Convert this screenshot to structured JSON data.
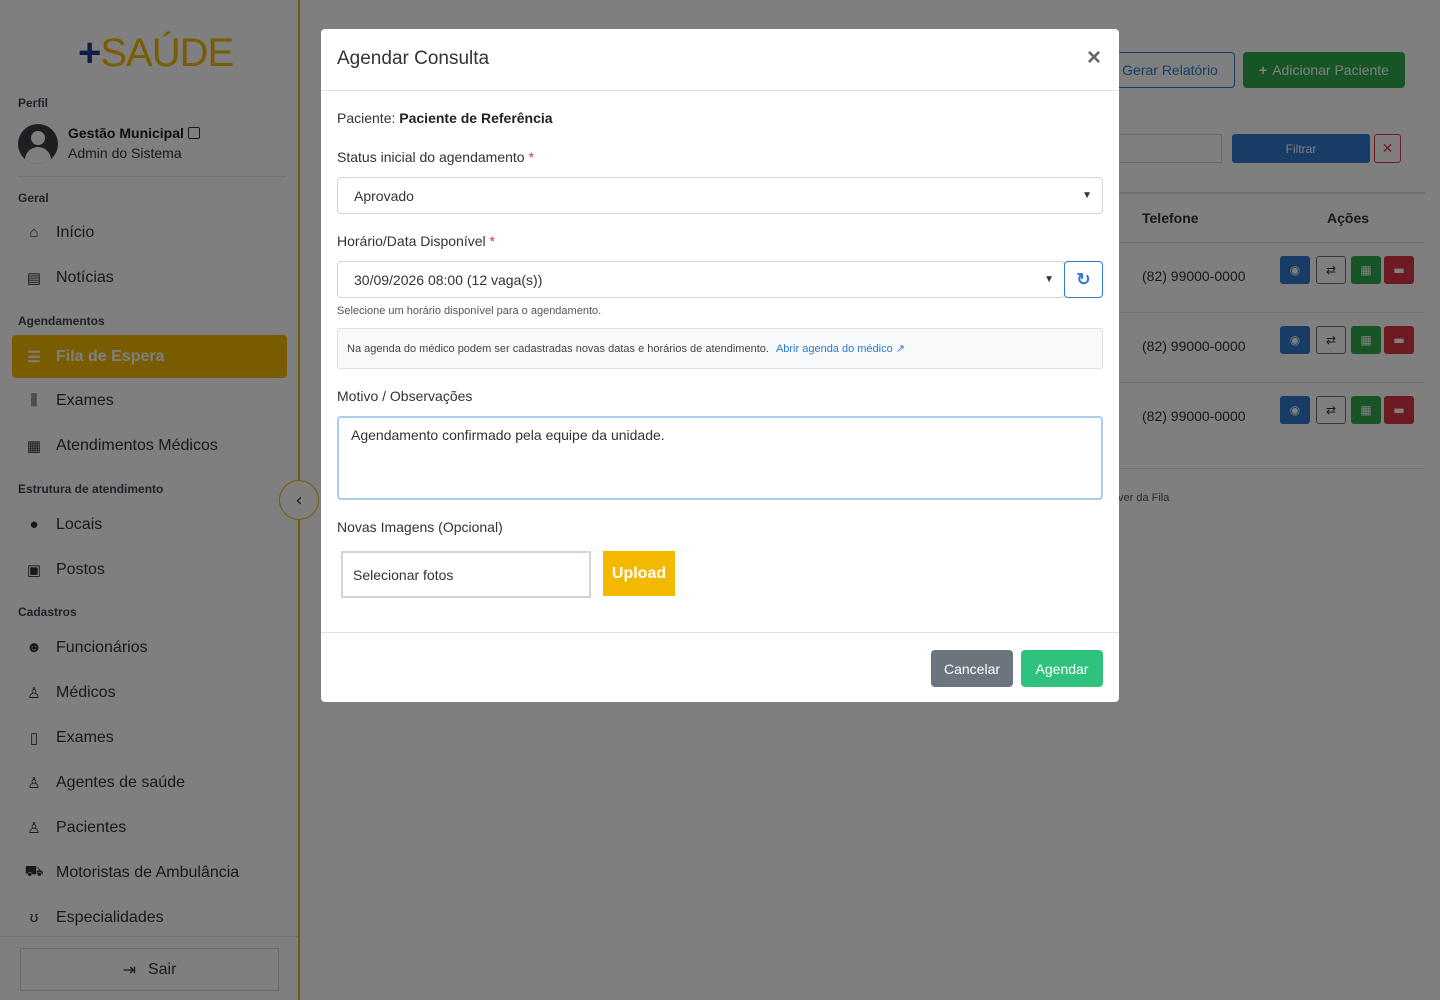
{
  "logo": {
    "plus": "+",
    "word": "SAÚDE"
  },
  "sidebar": {
    "profile_heading": "Perfil",
    "profile_name": "Gestão Municipal",
    "profile_role": "Admin do Sistema",
    "sections": {
      "geral": "Geral",
      "agendamentos": "Agendamentos",
      "estrutura": "Estrutura de atendimento",
      "cadastros": "Cadastros"
    },
    "items": [
      {
        "label": "Início",
        "icon": "home-icon"
      },
      {
        "label": "Notícias",
        "icon": "newspaper-icon"
      },
      {
        "label": "Fila de Espera",
        "icon": "list-icon",
        "active": true
      },
      {
        "label": "Exames",
        "icon": "vials-icon"
      },
      {
        "label": "Atendimentos Médicos",
        "icon": "calendar-check-icon"
      },
      {
        "label": "Locais",
        "icon": "map-marker-icon"
      },
      {
        "label": "Postos",
        "icon": "hospital-icon"
      },
      {
        "label": "Funcionários",
        "icon": "users-icon"
      },
      {
        "label": "Médicos",
        "icon": "doctor-icon"
      },
      {
        "label": "Exames",
        "icon": "file-medical-icon"
      },
      {
        "label": "Agentes de saúde",
        "icon": "user-nurse-icon"
      },
      {
        "label": "Pacientes",
        "icon": "user-injured-icon"
      },
      {
        "label": "Motoristas de Ambulância",
        "icon": "ambulance-icon"
      },
      {
        "label": "Especialidades",
        "icon": "stethoscope-icon"
      }
    ],
    "logout": "Sair"
  },
  "main": {
    "report_button": "Gerar Relatório",
    "add_button": "Adicionar Paciente",
    "filter_button": "Filtrar",
    "table": {
      "headers": [
        "Telefone",
        "Ações"
      ],
      "rows": [
        {
          "phone": "(82) 99000-0000"
        },
        {
          "phone": "(82) 99000-0000"
        },
        {
          "phone": "(82) 99000-0000"
        }
      ],
      "footer": "ver da Fila"
    }
  },
  "modal": {
    "title": "Agendar Consulta",
    "close": "×",
    "patient_label": "Paciente:",
    "patient_name": "Paciente de Referência",
    "status_label": "Status inicial do agendamento",
    "status_value": "Aprovado",
    "slot_label": "Horário/Data Disponível",
    "slot_value": "30/09/2026 08:00 (12 vaga(s))",
    "slot_help": "Selecione um horário disponível para o agendamento.",
    "info_text": "Na agenda do médico podem ser cadastradas novas datas e horários de atendimento.",
    "info_link": "Abrir agenda do médico",
    "notes_label": "Motivo / Observações",
    "notes_value": "Agendamento confirmado pela equipe da unidade.",
    "images_label": "Novas Imagens (Opcional)",
    "images_input": "Selecionar fotos",
    "upload_button": "Upload",
    "cancel_button": "Cancelar",
    "submit_button": "Agendar",
    "required_mark": "*"
  }
}
